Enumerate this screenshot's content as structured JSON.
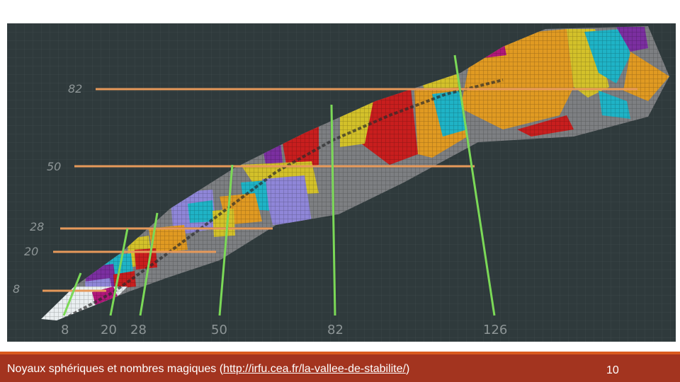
{
  "figure": {
    "proton_magic_labels": [
      "82",
      "50",
      "28",
      "20",
      "8"
    ],
    "neutron_magic_labels": [
      "8",
      "20",
      "28",
      "50",
      "82",
      "126"
    ],
    "colors": {
      "background": "#2f3a3c",
      "grid_gray": "#7d7f82",
      "red": "#c81e1e",
      "orange": "#e09a22",
      "yellow": "#d3c12a",
      "cyan": "#1fb3c6",
      "purple": "#7b2fa0",
      "lavender": "#8f86d8",
      "white": "#e9eef0",
      "magenta": "#b0177a",
      "proton_line": "#e6995a",
      "neutron_line": "#7bd957"
    }
  },
  "footer": {
    "caption_prefix": "Noyaux sphériques et nombres magiques (",
    "caption_link": "http://irfu.cea.fr/la-vallee-de-stabilite/",
    "caption_suffix": ")",
    "page_number": "10",
    "bar_color": "#a3341f",
    "accent_color": "#d95a1e"
  }
}
